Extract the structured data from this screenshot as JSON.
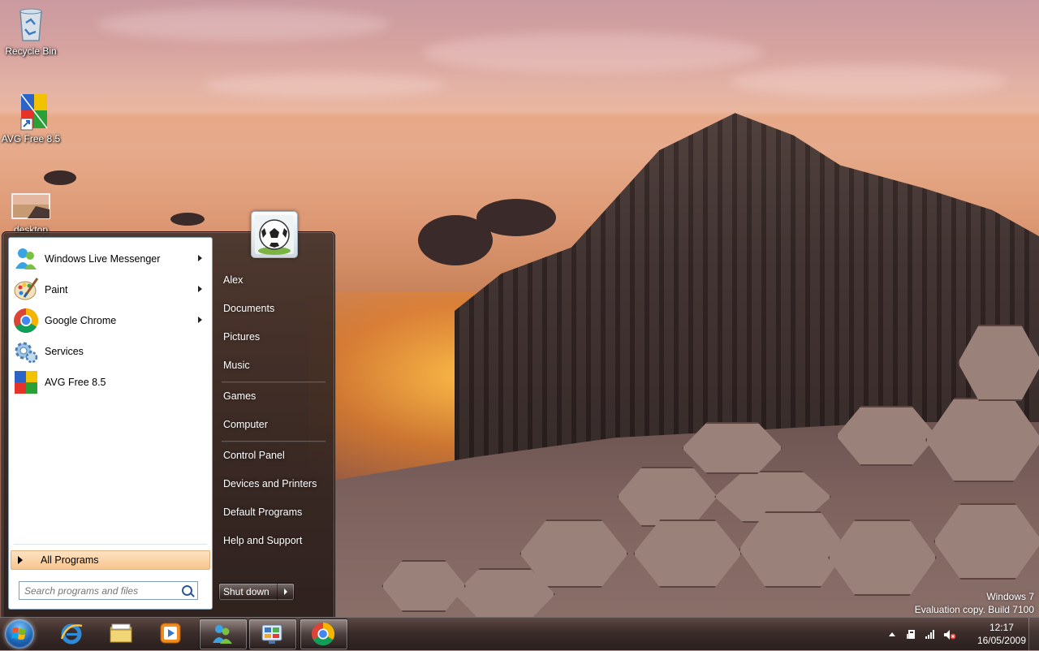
{
  "desktop": {
    "icons": [
      {
        "label": "Recycle Bin"
      },
      {
        "label": "AVG Free 8.5"
      },
      {
        "label": "desktop"
      }
    ],
    "watermark": {
      "line1": "Windows 7",
      "line2": "Evaluation copy. Build 7100"
    }
  },
  "start_menu": {
    "programs": [
      {
        "label": "Windows Live Messenger",
        "icon": "messenger-icon",
        "has_submenu": true
      },
      {
        "label": "Paint",
        "icon": "paint-icon",
        "has_submenu": true
      },
      {
        "label": "Google Chrome",
        "icon": "chrome-icon",
        "has_submenu": true
      },
      {
        "label": "Services",
        "icon": "services-icon",
        "has_submenu": false
      },
      {
        "label": "AVG Free 8.5",
        "icon": "avg-icon",
        "has_submenu": false
      }
    ],
    "all_programs": "All Programs",
    "search_placeholder": "Search programs and files",
    "user_picture": "soccer-ball-icon",
    "right_items": [
      {
        "label": "Alex"
      },
      {
        "label": "Documents"
      },
      {
        "label": "Pictures"
      },
      {
        "label": "Music"
      },
      {
        "label": "Games"
      },
      {
        "label": "Computer"
      },
      {
        "label": "Control Panel"
      },
      {
        "label": "Devices and Printers"
      },
      {
        "label": "Default Programs"
      },
      {
        "label": "Help and Support"
      }
    ],
    "shutdown_label": "Shut down"
  },
  "taskbar": {
    "pinned": [
      "internet-explorer-icon",
      "windows-explorer-icon",
      "media-player-icon",
      "messenger-icon",
      "control-panel-icon",
      "chrome-icon"
    ],
    "tray_icons": [
      "show-hidden-icons",
      "action-center-icon",
      "network-icon",
      "volume-muted-icon"
    ],
    "time": "12:17",
    "date": "16/05/2009"
  },
  "colors": {
    "all_programs_highlight": "#f8c58d",
    "start_orb": "#1e64b3"
  }
}
